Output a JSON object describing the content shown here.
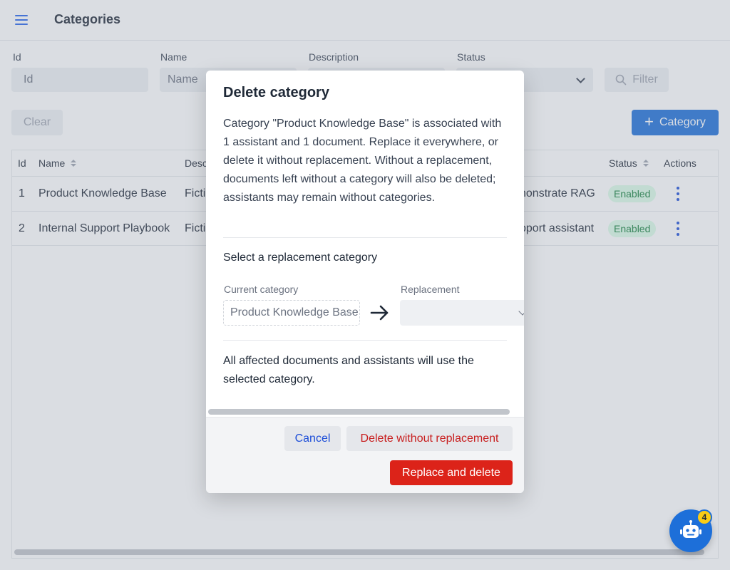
{
  "page": {
    "title": "Categories"
  },
  "filters": {
    "id": {
      "label": "Id",
      "placeholder": "Id"
    },
    "name": {
      "label": "Name",
      "placeholder": "Name"
    },
    "description": {
      "label": "Description"
    },
    "status": {
      "label": "Status"
    },
    "filter_button": "Filter",
    "clear_button": "Clear",
    "add_button": "Category"
  },
  "table": {
    "headers": {
      "id": "Id",
      "name": "Name",
      "description": "Desc",
      "status": "Status",
      "actions": "Actions"
    },
    "rows": [
      {
        "id": "1",
        "name": "Product Knowledge Base",
        "description_start": "Ficti",
        "description_end": "nonstrate RAG",
        "status": "Enabled"
      },
      {
        "id": "2",
        "name": "Internal Support Playbook",
        "description_start": "Ficti",
        "description_end": "pport assistant",
        "status": "Enabled"
      }
    ]
  },
  "dialog": {
    "title": "Delete category",
    "message": "Category \"Product Knowledge Base\" is associated with 1 assistant and 1 document. Replace it everywhere, or delete it without replacement. Without a replacement, documents left without a category will also be deleted; assistants may remain without categories.",
    "subtitle": "Select a replacement category",
    "current_label": "Current category",
    "current_value": "Product Knowledge Base",
    "replacement_label": "Replacement",
    "replacement_value": "",
    "note": "All affected documents and assistants will use the selected category.",
    "buttons": {
      "cancel": "Cancel",
      "delete_without_replacement": "Delete without replacement",
      "replace_and_delete": "Replace and delete"
    }
  },
  "assistant_fab": {
    "icon": "robot-icon",
    "badge_count": "4"
  },
  "colors": {
    "primary": "#1d6fd9",
    "danger": "#dc2319",
    "success_bg": "#dcfce7",
    "success_text": "#15803d",
    "badge": "#facc15"
  }
}
